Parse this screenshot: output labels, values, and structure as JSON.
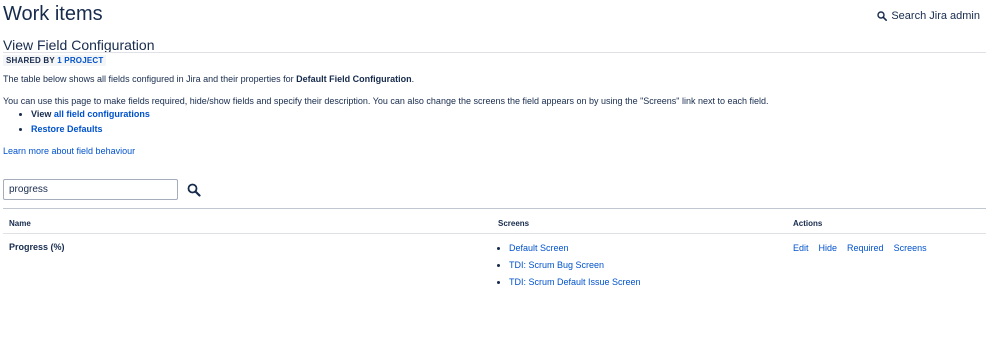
{
  "header": {
    "title": "Work items",
    "search_admin_label": "Search Jira admin"
  },
  "config": {
    "title": "View Field Configuration",
    "shared_prefix": "SHARED BY",
    "shared_link": "1 PROJECT",
    "desc_prefix": "The table below shows all fields configured in Jira and their properties for",
    "desc_config_name": "Default Field Configuration",
    "desc_suffix": ".",
    "desc2": "You can use this page to make fields required, hide/show fields and specify their description. You can also change the screens the field appears on by using the \"Screens\" link next to each field.",
    "option_view_prefix": "View",
    "option_view_link": "all field configurations",
    "option_restore": "Restore Defaults",
    "learn_more": "Learn more about field behaviour"
  },
  "search": {
    "value": "progress"
  },
  "table": {
    "headers": {
      "name": "Name",
      "screens": "Screens",
      "actions": "Actions"
    },
    "rows": [
      {
        "name": "Progress (%)",
        "screens": [
          "Default Screen",
          "TDI: Scrum Bug Screen",
          "TDI: Scrum Default Issue Screen"
        ],
        "actions": [
          "Edit",
          "Hide",
          "Required",
          "Screens"
        ]
      }
    ]
  },
  "icons": {
    "search": "search-icon"
  },
  "colors": {
    "link": "#0052cc",
    "text": "#172b4d"
  }
}
